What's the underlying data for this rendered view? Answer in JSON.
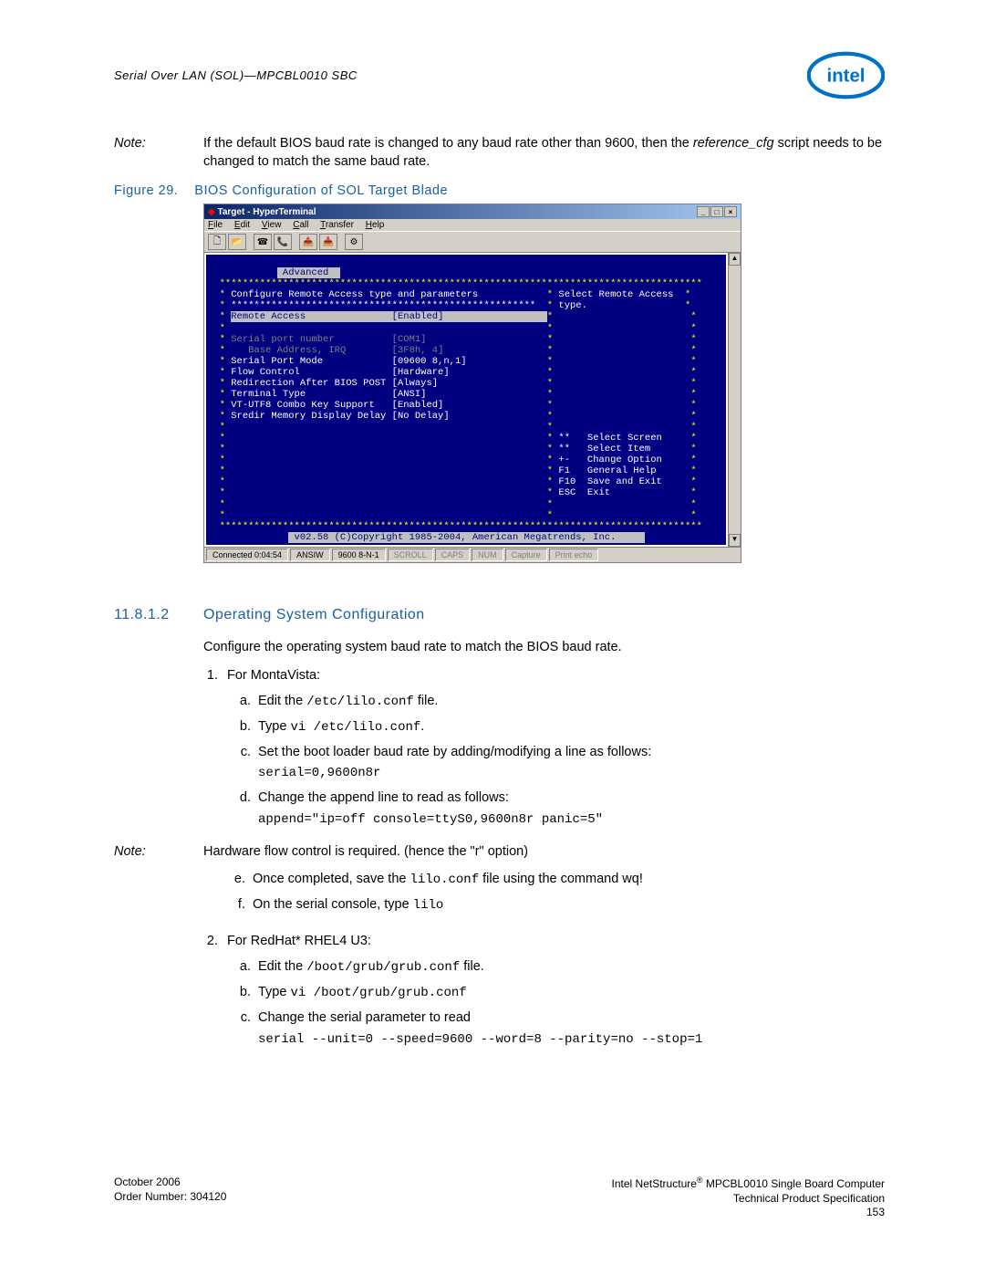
{
  "header": "Serial Over LAN (SOL)—MPCBL0010 SBC",
  "note1": {
    "label": "Note:",
    "text_before": "If the default BIOS baud rate is changed to any baud rate other than 9600, then the ",
    "italic": "reference_cfg",
    "text_after": " script needs to be changed to match the same baud rate."
  },
  "figure": {
    "number": "Figure 29.",
    "title": "BIOS Configuration of SOL Target Blade"
  },
  "hyperterm": {
    "title": "Target - HyperTerminal",
    "menus": [
      "File",
      "Edit",
      "View",
      "Call",
      "Transfer",
      "Help"
    ],
    "status": {
      "connected": "Connected 0:04:54",
      "emulation": "ANSIW",
      "settings": "9600 8-N-1",
      "flags": [
        "SCROLL",
        "CAPS",
        "NUM",
        "Capture",
        "Print echo"
      ]
    }
  },
  "bios": {
    "tab": "Advanced",
    "heading1": "Configure Remote Access type and parameters",
    "help1": "Select Remote Access",
    "help2": "type.",
    "rows": [
      {
        "label": "Remote Access",
        "value": "[Enabled]",
        "hl": true
      },
      {
        "label": "",
        "value": ""
      },
      {
        "label": "Serial port number",
        "value": "[COM1]",
        "gray": true
      },
      {
        "label": "   Base Address, IRQ",
        "value": "[3F8h, 4]",
        "gray": true
      },
      {
        "label": "Serial Port Mode",
        "value": "[09600 8,n,1]"
      },
      {
        "label": "Flow Control",
        "value": "[Hardware]"
      },
      {
        "label": "Redirection After BIOS POST",
        "value": "[Always]"
      },
      {
        "label": "Terminal Type",
        "value": "[ANSI]"
      },
      {
        "label": "VT-UTF8 Combo Key Support",
        "value": "[Enabled]"
      },
      {
        "label": "Sredir Memory Display Delay",
        "value": "[No Delay]"
      }
    ],
    "nav": [
      {
        "key": "**",
        "label": "Select Screen"
      },
      {
        "key": "**",
        "label": "Select Item"
      },
      {
        "key": "+-",
        "label": "Change Option"
      },
      {
        "key": "F1",
        "label": "General Help"
      },
      {
        "key": "F10",
        "label": "Save and Exit"
      },
      {
        "key": "ESC",
        "label": "Exit"
      }
    ],
    "copyright": "v02.58 (C)Copyright 1985-2004, American Megatrends, Inc."
  },
  "section": {
    "number": "11.8.1.2",
    "title": "Operating System Configuration"
  },
  "intro": "Configure the operating system baud rate to match the BIOS baud rate.",
  "li1": "For MontaVista:",
  "li1a_pre": "Edit the ",
  "li1a_code": "/etc/lilo.conf",
  "li1a_post": " file.",
  "li1b_pre": "Type ",
  "li1b_code": "vi /etc/lilo.conf",
  "li1b_post": ".",
  "li1c": "Set the boot loader baud rate by adding/modifying a line as follows:",
  "li1c_code": "serial=0,9600n8r",
  "li1d": "Change the append line to read as follows:",
  "li1d_code": "append=\"ip=off console=ttyS0,9600n8r panic=5\"",
  "note2": {
    "label": "Note:",
    "text": "Hardware flow control is required. (hence the \"r\" option)"
  },
  "li1e_pre": "Once completed, save the ",
  "li1e_code": "lilo.conf",
  "li1e_post": " file using the command wq!",
  "li1f_pre": "On the serial console, type ",
  "li1f_code": "lilo",
  "li2": "For RedHat* RHEL4 U3:",
  "li2a_pre": "Edit the ",
  "li2a_code": "/boot/grub/grub.conf",
  "li2a_post": " file.",
  "li2b_pre": "Type ",
  "li2b_code": "vi /boot/grub/grub.conf",
  "li2c": "Change the serial parameter to read",
  "li2c_code": "serial --unit=0 --speed=9600 --word=8 --parity=no --stop=1",
  "footer": {
    "left1": "October 2006",
    "left2": "Order Number: 304120",
    "right1_pre": "Intel NetStructure",
    "right1_post": " MPCBL0010 Single Board Computer",
    "right2": "Technical Product Specification",
    "right3": "153"
  }
}
